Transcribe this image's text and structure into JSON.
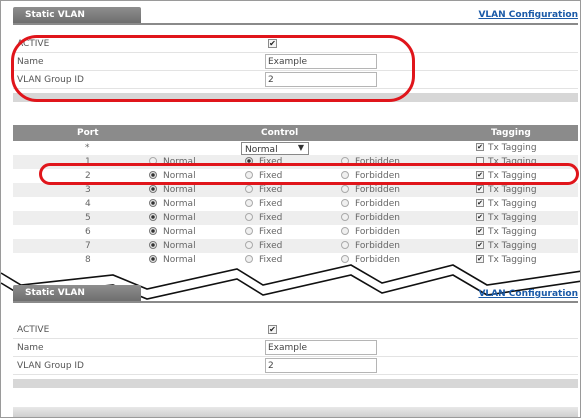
{
  "top_panel": {
    "tab_title": "Static VLAN",
    "config_link": "VLAN Configuration",
    "fields": [
      {
        "label": "ACTIVE",
        "checked": "✔"
      },
      {
        "label": "Name",
        "value": "Example"
      },
      {
        "label": "VLAN Group ID",
        "value": "2"
      }
    ]
  },
  "ports_table": {
    "headers": {
      "port": "Port",
      "control": "Control",
      "tagging": "Tagging"
    },
    "all_row": {
      "port": "*",
      "select_value": "Normal",
      "select_arrow": "▼",
      "tag_label": "Tx Tagging",
      "tag_checked": "✔"
    },
    "option_labels": {
      "normal": "Normal",
      "fixed": "Fixed",
      "forbidden": "Forbidden"
    },
    "rows": [
      {
        "port": "1",
        "selected": "fixed",
        "tag_label": "Tx Tagging",
        "tag_checked": ""
      },
      {
        "port": "2",
        "selected": "normal",
        "tag_label": "Tx Tagging",
        "tag_checked": "✔"
      },
      {
        "port": "3",
        "selected": "normal",
        "tag_label": "Tx Tagging",
        "tag_checked": "✔"
      },
      {
        "port": "4",
        "selected": "normal",
        "tag_label": "Tx Tagging",
        "tag_checked": "✔"
      },
      {
        "port": "5",
        "selected": "normal",
        "tag_label": "Tx Tagging",
        "tag_checked": "✔"
      },
      {
        "port": "6",
        "selected": "normal",
        "tag_label": "Tx Tagging",
        "tag_checked": "✔"
      },
      {
        "port": "7",
        "selected": "normal",
        "tag_label": "Tx Tagging",
        "tag_checked": "✔"
      },
      {
        "port": "8",
        "selected": "normal",
        "tag_label": "Tx Tagging",
        "tag_checked": "✔"
      }
    ]
  },
  "bottom_panel": {
    "tab_title": "Static VLAN",
    "config_link": "VLAN Configuration",
    "fields": [
      {
        "label": "ACTIVE",
        "checked": "✔"
      },
      {
        "label": "Name",
        "value": "Example"
      },
      {
        "label": "VLAN Group ID",
        "value": "2"
      }
    ]
  },
  "colors": {
    "highlight": "#e0151b",
    "header_bg": "#8b8b8b",
    "link": "#1a5aa8"
  }
}
